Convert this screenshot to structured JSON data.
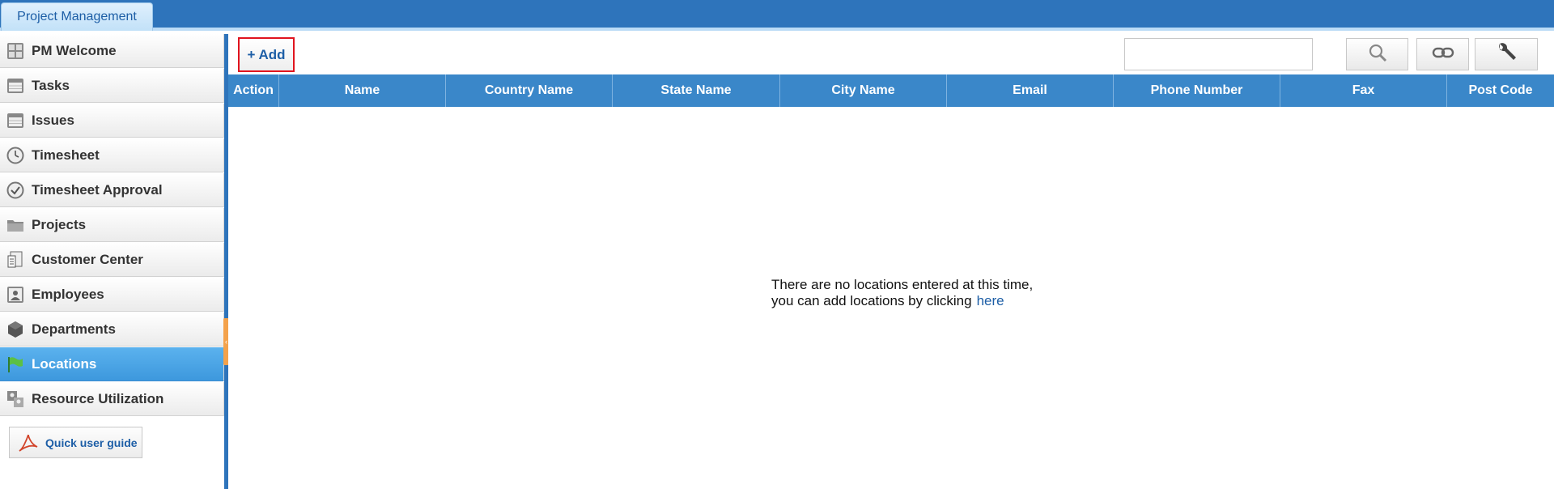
{
  "top_tab": {
    "label": "Project Management"
  },
  "sidebar": {
    "items": [
      {
        "label": "PM Welcome",
        "icon": "dashboard-icon",
        "active": false
      },
      {
        "label": "Tasks",
        "icon": "window-icon",
        "active": false
      },
      {
        "label": "Issues",
        "icon": "window-icon",
        "active": false
      },
      {
        "label": "Timesheet",
        "icon": "clock-icon",
        "active": false
      },
      {
        "label": "Timesheet Approval",
        "icon": "check-circle-icon",
        "active": false
      },
      {
        "label": "Projects",
        "icon": "folder-icon",
        "active": false
      },
      {
        "label": "Customer Center",
        "icon": "document-icon",
        "active": false
      },
      {
        "label": "Employees",
        "icon": "employee-icon",
        "active": false
      },
      {
        "label": "Departments",
        "icon": "cube-icon",
        "active": false
      },
      {
        "label": "Locations",
        "icon": "flag-icon",
        "active": true
      },
      {
        "label": "Resource Utilization",
        "icon": "resource-icon",
        "active": false
      }
    ],
    "guide_label": "Quick user guide"
  },
  "toolbar": {
    "add_label": "+ Add",
    "search_value": "",
    "search_placeholder": ""
  },
  "grid": {
    "columns": [
      "Action",
      "Name",
      "Country Name",
      "State Name",
      "City Name",
      "Email",
      "Phone Number",
      "Fax",
      "Post Code"
    ],
    "rows": []
  },
  "empty_state": {
    "line1": "There are no locations entered at this time,",
    "line2": "you can add locations by clicking",
    "link": "here"
  },
  "colors": {
    "header_blue": "#3a87c9",
    "topbar_blue": "#2e74bb",
    "active_item": "#4aa5e6",
    "add_border": "#e0141e"
  }
}
